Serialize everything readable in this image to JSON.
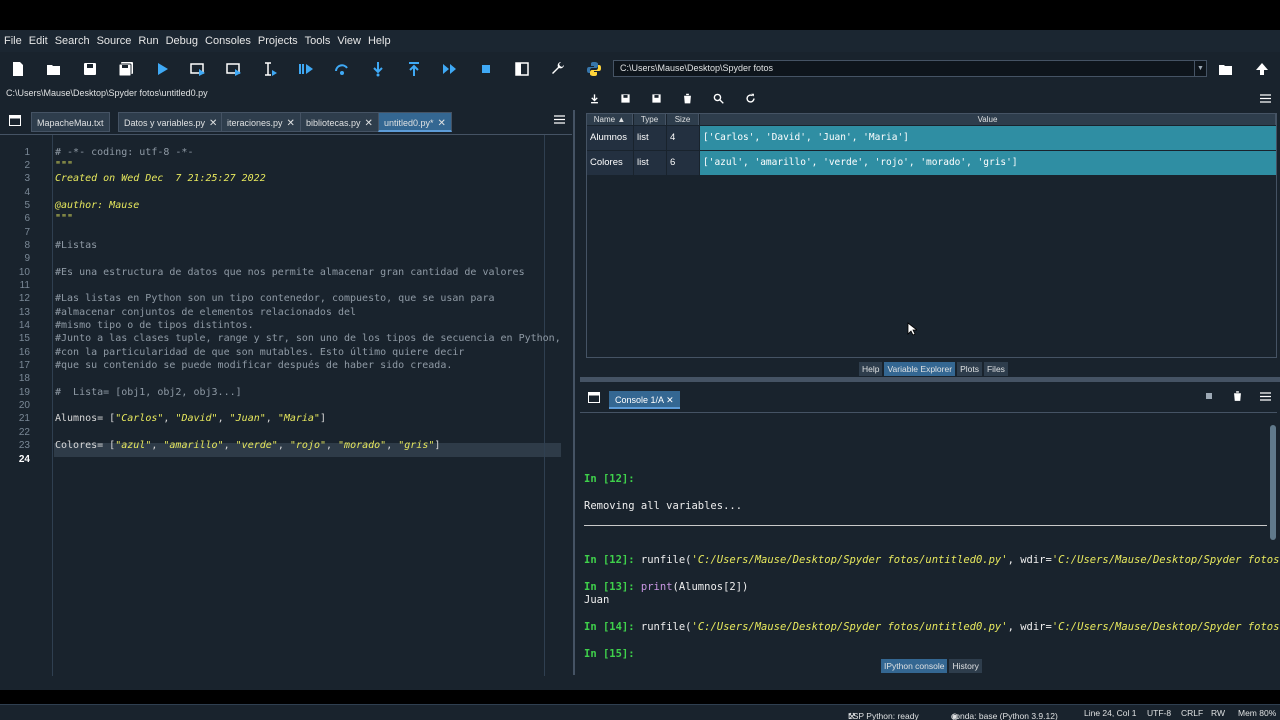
{
  "menu": [
    "File",
    "Edit",
    "Search",
    "Source",
    "Run",
    "Debug",
    "Consoles",
    "Projects",
    "Tools",
    "View",
    "Help"
  ],
  "toolbar": {
    "working_dir": "C:\\Users\\Mause\\Desktop\\Spyder fotos"
  },
  "editor": {
    "file_path": "C:\\Users\\Mause\\Desktop\\Spyder fotos\\untitled0.py",
    "tabs": [
      {
        "label": "MapacheMau.txt"
      },
      {
        "label": "Datos y variables.py"
      },
      {
        "label": "iteraciones.py"
      },
      {
        "label": "bibliotecas.py"
      },
      {
        "label": "untitled0.py*",
        "active": true
      }
    ],
    "line_numbers": [
      "1",
      "2",
      "3",
      "4",
      "5",
      "6",
      "7",
      "8",
      "9",
      "10",
      "11",
      "12",
      "13",
      "14",
      "15",
      "16",
      "17",
      "18",
      "19",
      "20",
      "21",
      "22",
      "23",
      "24"
    ],
    "lines": {
      "l1": "# -*- coding: utf-8 -*-",
      "l2": "\"\"\"",
      "l3": "Created on Wed Dec  7 21:25:27 2022",
      "l5": "@author: Mause",
      "l6": "\"\"\"",
      "l8": "#Listas",
      "l10": "#Es una estructura de datos que nos permite almacenar gran cantidad de valores",
      "l12": "#Las listas en Python son un tipo contenedor, compuesto, que se usan para",
      "l13": "#almacenar conjuntos de elementos relacionados del",
      "l14": "#mismo tipo o de tipos distintos.",
      "l15": "#Junto a las clases tuple, range y str, son uno de los tipos de secuencia en Python,",
      "l16": "#con la particularidad de que son mutables. Esto último quiere decir",
      "l17": "#que su contenido se puede modificar después de haber sido creada.",
      "l19": "#  Lista= [obj1, obj2, obj3...]",
      "l21_a": "Alumnos= [",
      "l21_s1": "\"Carlos\"",
      "l21_s2": "\"David\"",
      "l21_s3": "\"Juan\"",
      "l21_s4": "\"Maria\"",
      "l23_a": "Colores= [",
      "l23_s1": "\"azul\"",
      "l23_s2": "\"amarillo\"",
      "l23_s3": "\"verde\"",
      "l23_s4": "\"rojo\"",
      "l23_s5": "\"morado\"",
      "l23_s6": "\"gris\""
    }
  },
  "variable_explorer": {
    "columns": [
      "Name",
      "Type",
      "Size",
      "Value"
    ],
    "rows": [
      {
        "name": "Alumnos",
        "type": "list",
        "size": "4",
        "value": "['Carlos', 'David', 'Juan', 'Maria']"
      },
      {
        "name": "Colores",
        "type": "list",
        "size": "6",
        "value": "['azul', 'amarillo', 'verde', 'rojo', 'morado', 'gris']"
      }
    ],
    "pane_tabs": [
      "Help",
      "Variable Explorer",
      "Plots",
      "Files"
    ]
  },
  "console": {
    "tab_label": "Console 1/A",
    "p12a": "In [12]:",
    "removing": "Removing all variables...",
    "p12b": "In [12]:",
    "runfile_fn": "runfile",
    "runfile_path": "'C:/Users/Mause/Desktop/Spyder fotos/untitled0.py'",
    "runfile_wdir": ", wdir=",
    "runfile_wdir_val": "'C:/Users/Mause/Desktop/Spyder fotos'",
    "p13": "In [13]:",
    "print_fn": "print",
    "print_arg": "(Alumnos[2])",
    "output": "Juan",
    "p14": "In [14]:",
    "p15": "In [15]:",
    "pane_tabs": [
      "IPython console",
      "History"
    ]
  },
  "status": {
    "lsp": "LSP Python: ready",
    "conda": "conda: base (Python 3.9.12)",
    "position": "Line 24, Col 1",
    "encoding": "UTF-8",
    "eol": "CRLF",
    "rw": "RW",
    "mem": "Mem 80%"
  }
}
